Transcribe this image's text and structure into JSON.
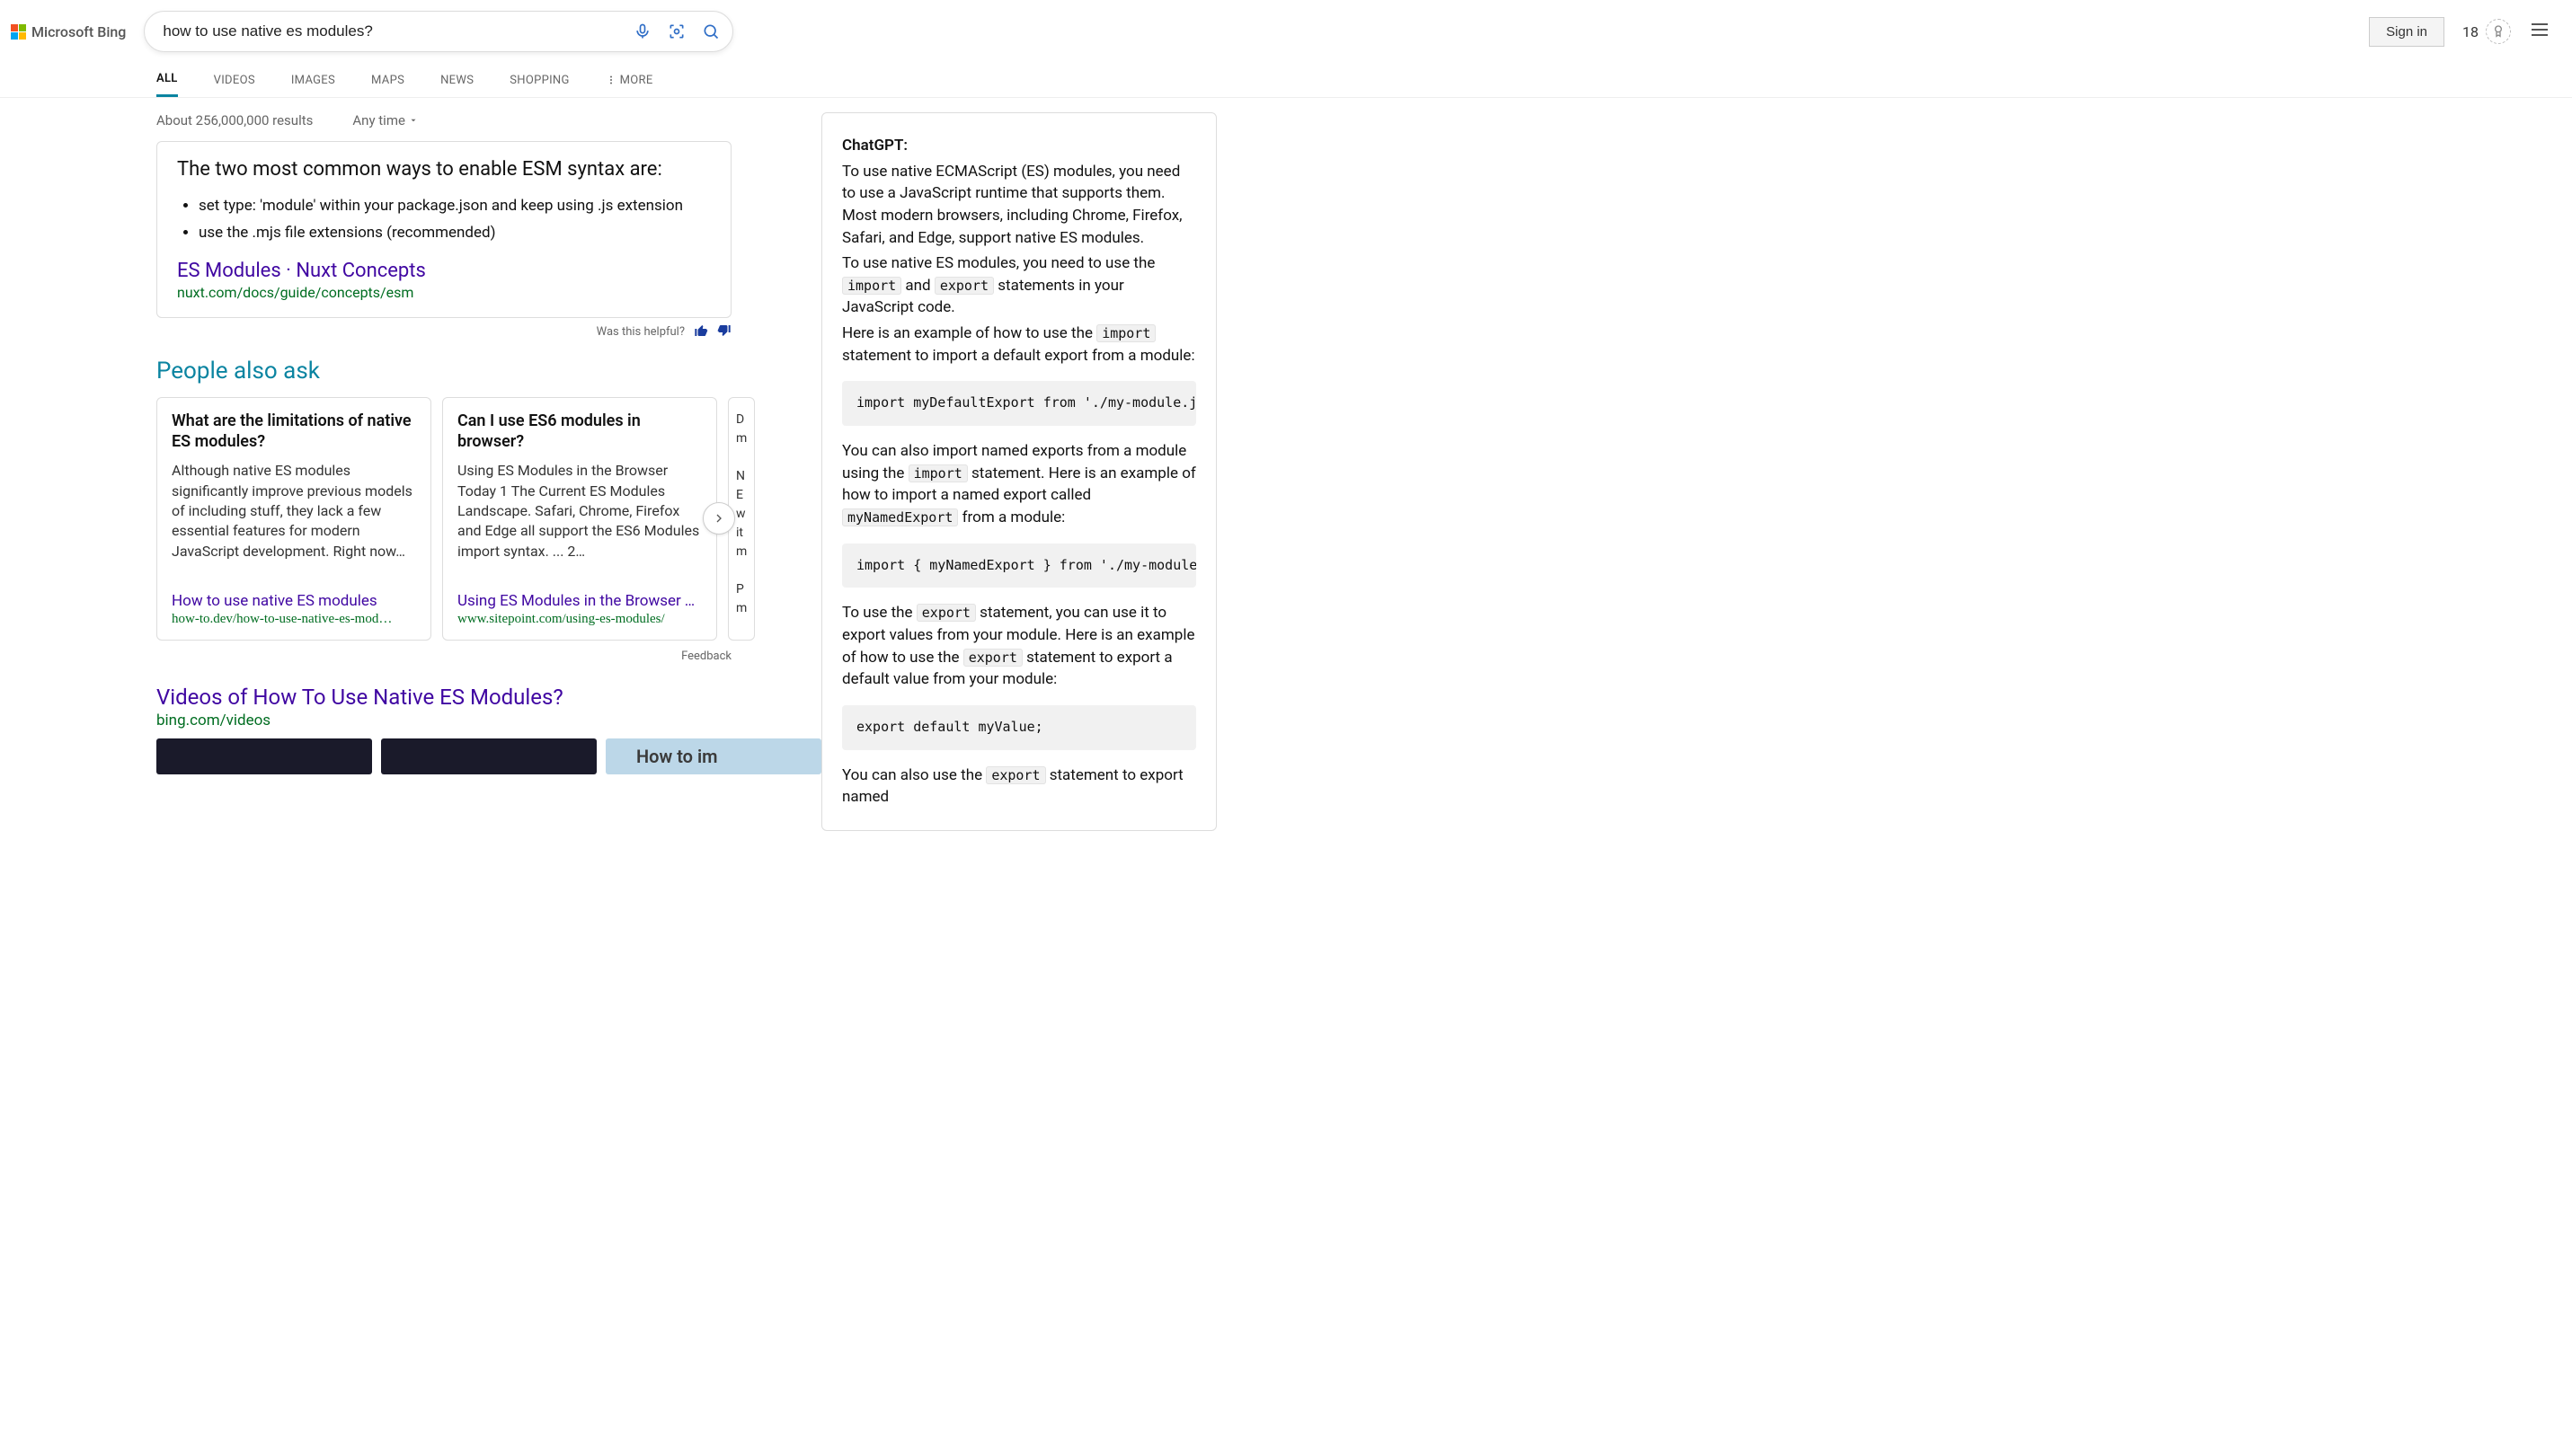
{
  "brand": "Microsoft Bing",
  "search": {
    "query": "how to use native es modules?"
  },
  "header": {
    "signin": "Sign in",
    "rewards_count": "18"
  },
  "tabs": {
    "all": "ALL",
    "videos": "VIDEOS",
    "images": "IMAGES",
    "maps": "MAPS",
    "news": "NEWS",
    "shopping": "SHOPPING",
    "more": "MORE"
  },
  "stats": {
    "count": "About 256,000,000 results",
    "anytime": "Any time"
  },
  "answer": {
    "heading": "The two most common ways to enable ESM syntax are:",
    "bullets": {
      "b0": "set type: 'module' within your package.json and keep using .js extension",
      "b1": "use the .mjs file extensions (recommended)"
    },
    "src_title": "ES Modules · Nuxt Concepts",
    "src_url": "nuxt.com/docs/guide/concepts/esm"
  },
  "helpful": {
    "label": "Was this helpful?"
  },
  "paa": {
    "title": "People also ask",
    "cards": {
      "c0": {
        "q": "What are the limitations of native ES modules?",
        "body": "Although native ES modules significantly improve previous models of including stuff, they lack a few essential features for modern JavaScript development. Right now…",
        "link": "How to use native ES modules",
        "url": "how-to.dev/how-to-use-native-es-mod…"
      },
      "c1": {
        "q": "Can I use ES6 modules in browser?",
        "body": "Using ES Modules in the Browser Today 1 The Current ES Modules Landscape. Safari, Chrome, Firefox and Edge all support the ES6 Modules import syntax. ... 2…",
        "link": "Using ES Modules in the Browser T…",
        "url": "www.sitepoint.com/using-es-modules/"
      },
      "c2": {
        "frag": "D\nm\n\nN\nE\nw\nit\nm\n\nP\nm"
      }
    }
  },
  "feedback": "Feedback",
  "videos": {
    "title": "Videos of How To Use Native ES Modules?",
    "url": "bing.com/videos",
    "thumb3_text": "How to im"
  },
  "chat": {
    "label": "ChatGPT:",
    "p1": "To use native ECMAScript (ES) modules, you need to use a JavaScript runtime that supports them. Most modern browsers, including Chrome, Firefox, Safari, and Edge, support native ES modules.",
    "p2a": "To use native ES modules, you need to use the ",
    "p2b": " and ",
    "p2c": " statements in your JavaScript code.",
    "p3a": "Here is an example of how to use the ",
    "p3b": " statement to import a default export from a module:",
    "code1": "import myDefaultExport from './my-module.js';",
    "p4a": "You can also import named exports from a module using the ",
    "p4b": " statement. Here is an example of how to import a named export called ",
    "p4c": " from a module:",
    "code2": "import { myNamedExport } from './my-module.js';",
    "p5a": "To use the ",
    "p5b": " statement, you can use it to export values from your module. Here is an example of how to use the ",
    "p5c": " statement to export a default value from your module:",
    "code3": "export default myValue;",
    "p6a": "You can also use the ",
    "p6b": " statement to export named",
    "kw_import": "import",
    "kw_export": "export",
    "kw_named": "myNamedExport"
  }
}
